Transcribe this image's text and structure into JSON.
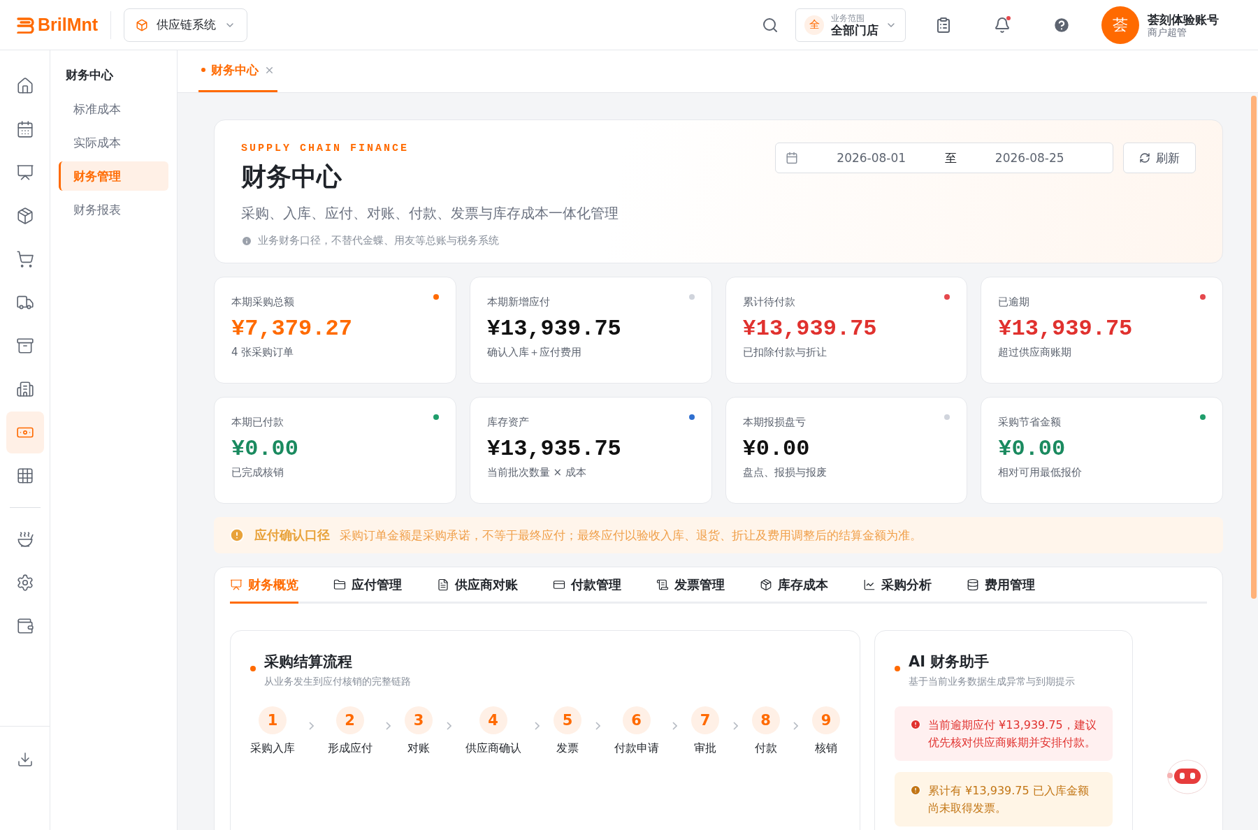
{
  "brand": {
    "name": "BrilMnt"
  },
  "system_selector": {
    "label": "供应链系统"
  },
  "scope": {
    "badge": "全",
    "label": "业务范围",
    "value": "全部门店"
  },
  "notifications": {
    "unread": true
  },
  "user": {
    "avatar": "荟",
    "name": "荟刻体验账号",
    "role": "商户超管"
  },
  "rail": {
    "main": [
      {
        "selected": false
      },
      {
        "selected": false
      },
      {
        "selected": false
      },
      {
        "selected": false
      },
      {
        "selected": false
      },
      {
        "selected": false
      },
      {
        "selected": false
      },
      {
        "selected": false
      },
      {
        "selected": true
      },
      {
        "selected": false
      }
    ],
    "extra": [
      {
        "selected": false
      },
      {
        "selected": false
      },
      {
        "selected": false
      }
    ]
  },
  "submenu": {
    "title": "财务中心",
    "items": [
      {
        "label": "标准成本",
        "selected": false
      },
      {
        "label": "实际成本",
        "selected": false
      },
      {
        "label": "财务管理",
        "selected": true
      },
      {
        "label": "财务报表",
        "selected": false
      }
    ]
  },
  "page_tabs": [
    {
      "label": "财务中心",
      "selected": true
    }
  ],
  "header": {
    "eyebrow": "SUPPLY CHAIN FINANCE",
    "title": "财务中心",
    "subtitle": "采购、入库、应付、对账、付款、发票与库存成本一体化管理",
    "note": "业务财务口径，不替代金蝶、用友等总账与税务系统",
    "date_range": {
      "start": "2026-08-01",
      "separator": "至",
      "end": "2026-08-25"
    },
    "refresh_button": "刷新"
  },
  "stats": [
    {
      "label": "本期采购总额",
      "value": "¥7,379.27",
      "caption": "4 张采购订单",
      "kind": "highlight",
      "color": "#ff6a00"
    },
    {
      "label": "本期新增应付",
      "value": "¥13,939.75",
      "caption": "确认入库＋应付费用",
      "kind": "plain",
      "color": "#d0d4dc"
    },
    {
      "label": "累计待付款",
      "value": "¥13,939.75",
      "caption": "已扣除付款与折让",
      "kind": "danger",
      "color": "#e5484d"
    },
    {
      "label": "已逾期",
      "value": "¥13,939.75",
      "caption": "超过供应商账期",
      "kind": "danger",
      "color": "#e5484d"
    },
    {
      "label": "本期已付款",
      "value": "¥0.00",
      "caption": "已完成核销",
      "kind": "success",
      "color": "#1f9d6b"
    },
    {
      "label": "库存资产",
      "value": "¥13,935.75",
      "caption": "当前批次数量 × 成本",
      "kind": "plain",
      "color": "#2f6fd0"
    },
    {
      "label": "本期报损盘亏",
      "value": "¥0.00",
      "caption": "盘点、报损与报废",
      "kind": "plain",
      "color": "#d0d4dc"
    },
    {
      "label": "采购节省金额",
      "value": "¥0.00",
      "caption": "相对可用最低报价",
      "kind": "success",
      "color": "#1f9d6b"
    }
  ],
  "notice": {
    "title": "应付确认口径",
    "text": "采购订单金额是采购承诺，不等于最终应付；最终应付以验收入库、退货、折让及费用调整后的结算金额为准。"
  },
  "tabs": [
    {
      "label": "财务概览",
      "selected": true
    },
    {
      "label": "应付管理",
      "selected": false
    },
    {
      "label": "供应商对账",
      "selected": false
    },
    {
      "label": "付款管理",
      "selected": false
    },
    {
      "label": "发票管理",
      "selected": false
    },
    {
      "label": "库存成本",
      "selected": false
    },
    {
      "label": "采购分析",
      "selected": false
    },
    {
      "label": "费用管理",
      "selected": false
    }
  ],
  "flow": {
    "title": "采购结算流程",
    "subtitle": "从业务发生到应付核销的完整链路",
    "steps": [
      {
        "number": "1",
        "label": "采购入库"
      },
      {
        "number": "2",
        "label": "形成应付"
      },
      {
        "number": "3",
        "label": "对账"
      },
      {
        "number": "4",
        "label": "供应商确认"
      },
      {
        "number": "5",
        "label": "发票"
      },
      {
        "number": "6",
        "label": "付款申请"
      },
      {
        "number": "7",
        "label": "审批"
      },
      {
        "number": "8",
        "label": "付款"
      },
      {
        "number": "9",
        "label": "核销"
      }
    ]
  },
  "assistant": {
    "title": "AI 财务助手",
    "subtitle": "基于当前业务数据生成异常与到期提示",
    "alerts": [
      {
        "kind": "danger",
        "text": "当前逾期应付 ¥13,939.75，建议优先核对供应商账期并安排付款。"
      },
      {
        "kind": "warning",
        "text": "累计有 ¥13,939.75 已入库金额尚未取得发票。"
      }
    ]
  }
}
